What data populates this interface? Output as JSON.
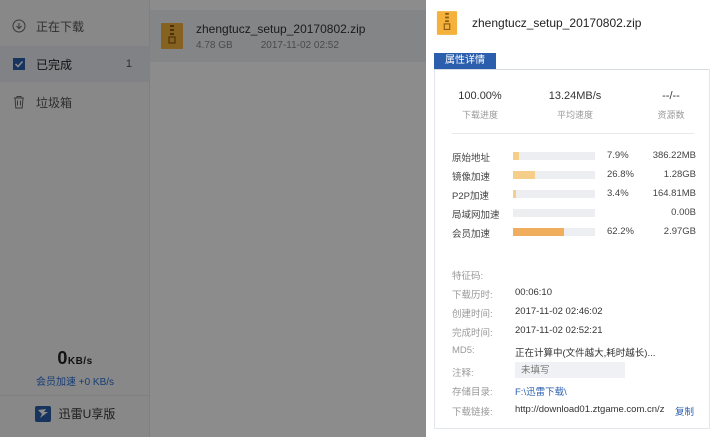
{
  "sidebar": {
    "items": [
      {
        "label": "正在下载",
        "count": ""
      },
      {
        "label": "已完成",
        "count": "1"
      },
      {
        "label": "垃圾箱",
        "count": ""
      }
    ],
    "speed": {
      "value": "0",
      "unit": "KB/s",
      "vip_text": "会员加速 +0 KB/s"
    },
    "brand": "迅雷U享版"
  },
  "list": {
    "file": {
      "name": "zhengtucz_setup_20170802.zip",
      "size": "4.78 GB",
      "time": "2017-11-02 02:52"
    }
  },
  "panel": {
    "title": "zhengtucz_setup_20170802.zip",
    "tab": "属性详情",
    "stats": [
      {
        "value": "100.00%",
        "label": "下载进度"
      },
      {
        "value": "13.24MB/s",
        "label": "平均速度"
      },
      {
        "value": "--/--",
        "label": "资源数"
      }
    ],
    "sources": [
      {
        "label": "原始地址",
        "fraction": 0.079,
        "pct": "7.9%",
        "size": "386.22MB"
      },
      {
        "label": "镜像加速",
        "fraction": 0.268,
        "pct": "26.8%",
        "size": "1.28GB"
      },
      {
        "label": "P2P加速",
        "fraction": 0.034,
        "pct": "3.4%",
        "size": "164.81MB"
      },
      {
        "label": "局域网加速",
        "fraction": 0,
        "pct": "",
        "size": "0.00B"
      },
      {
        "label": "会员加速",
        "fraction": 0.622,
        "pct": "62.2%",
        "size": "2.97GB"
      }
    ],
    "info": {
      "feature_label": "特征码:",
      "duration_label": "下载历时:",
      "duration": "00:06:10",
      "created_label": "创建时间:",
      "created": "2017-11-02 02:46:02",
      "completed_label": "完成时间:",
      "completed": "2017-11-02 02:52:21",
      "md5_label": "MD5:",
      "md5": "正在计算中(文件越大,耗时越长)...",
      "note_label": "注释:",
      "note_placeholder": "未填写",
      "dir_label": "存储目录:",
      "dir": "F:\\迅雷下载\\",
      "link_label": "下载链接:",
      "link": "http://download01.ztgame.com.cn/z...",
      "copy": "复制"
    }
  },
  "colors": {
    "accent": "#2b5fae",
    "bar_light": "#f5cf8a",
    "bar_strong": "#f0ad5c",
    "track": "#eceef2"
  }
}
